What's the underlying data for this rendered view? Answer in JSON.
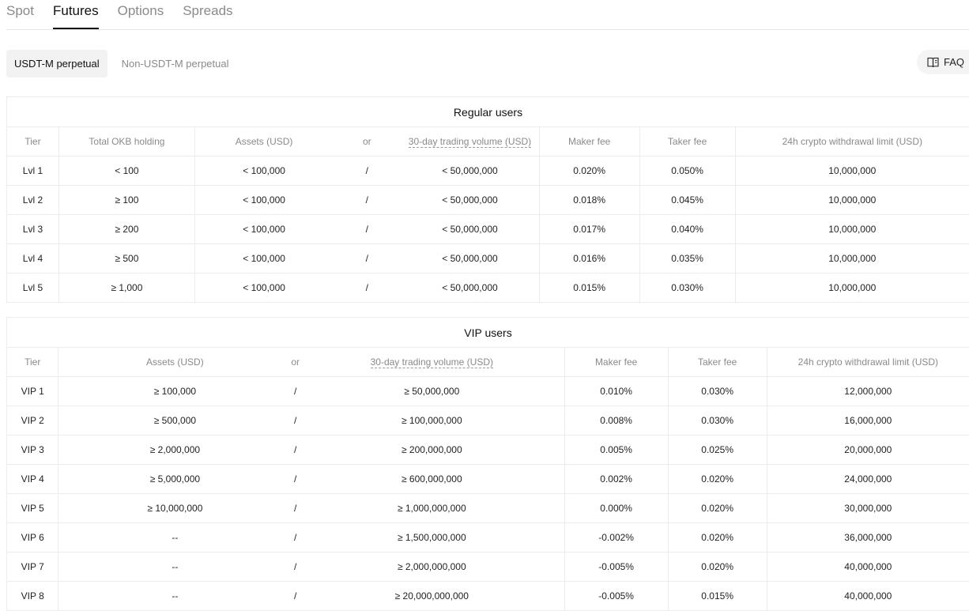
{
  "tabs": [
    "Spot",
    "Futures",
    "Options",
    "Spreads"
  ],
  "active_tab": "Futures",
  "subtabs": [
    "USDT-M perpetual",
    "Non-USDT-M perpetual"
  ],
  "faq_label": "FAQ",
  "regular": {
    "title": "Regular users",
    "headers": [
      "Tier",
      "Total OKB holding",
      "Assets (USD)",
      "or",
      "30-day trading volume (USD)",
      "Maker fee",
      "Taker fee",
      "24h crypto withdrawal limit (USD)"
    ],
    "rows": [
      [
        "Lvl 1",
        "< 100",
        "< 100,000",
        "/",
        "< 50,000,000",
        "0.020%",
        "0.050%",
        "10,000,000"
      ],
      [
        "Lvl 2",
        "≥ 100",
        "< 100,000",
        "/",
        "< 50,000,000",
        "0.018%",
        "0.045%",
        "10,000,000"
      ],
      [
        "Lvl 3",
        "≥ 200",
        "< 100,000",
        "/",
        "< 50,000,000",
        "0.017%",
        "0.040%",
        "10,000,000"
      ],
      [
        "Lvl 4",
        "≥ 500",
        "< 100,000",
        "/",
        "< 50,000,000",
        "0.016%",
        "0.035%",
        "10,000,000"
      ],
      [
        "Lvl 5",
        "≥ 1,000",
        "< 100,000",
        "/",
        "< 50,000,000",
        "0.015%",
        "0.030%",
        "10,000,000"
      ]
    ]
  },
  "vip": {
    "title": "VIP users",
    "headers": [
      "Tier",
      "Assets (USD)",
      "or",
      "30-day trading volume (USD)",
      "Maker fee",
      "Taker fee",
      "24h crypto withdrawal limit (USD)"
    ],
    "rows": [
      [
        "VIP 1",
        "≥ 100,000",
        "/",
        "≥ 50,000,000",
        "0.010%",
        "0.030%",
        "12,000,000"
      ],
      [
        "VIP 2",
        "≥ 500,000",
        "/",
        "≥ 100,000,000",
        "0.008%",
        "0.030%",
        "16,000,000"
      ],
      [
        "VIP 3",
        "≥ 2,000,000",
        "/",
        "≥ 200,000,000",
        "0.005%",
        "0.025%",
        "20,000,000"
      ],
      [
        "VIP 4",
        "≥ 5,000,000",
        "/",
        "≥ 600,000,000",
        "0.002%",
        "0.020%",
        "24,000,000"
      ],
      [
        "VIP 5",
        "≥ 10,000,000",
        "/",
        "≥ 1,000,000,000",
        "0.000%",
        "0.020%",
        "30,000,000"
      ],
      [
        "VIP 6",
        "--",
        "/",
        "≥ 1,500,000,000",
        "-0.002%",
        "0.020%",
        "36,000,000"
      ],
      [
        "VIP 7",
        "--",
        "/",
        "≥ 2,000,000,000",
        "-0.005%",
        "0.020%",
        "40,000,000"
      ],
      [
        "VIP 8",
        "--",
        "/",
        "≥ 20,000,000,000",
        "-0.005%",
        "0.015%",
        "40,000,000"
      ]
    ]
  }
}
